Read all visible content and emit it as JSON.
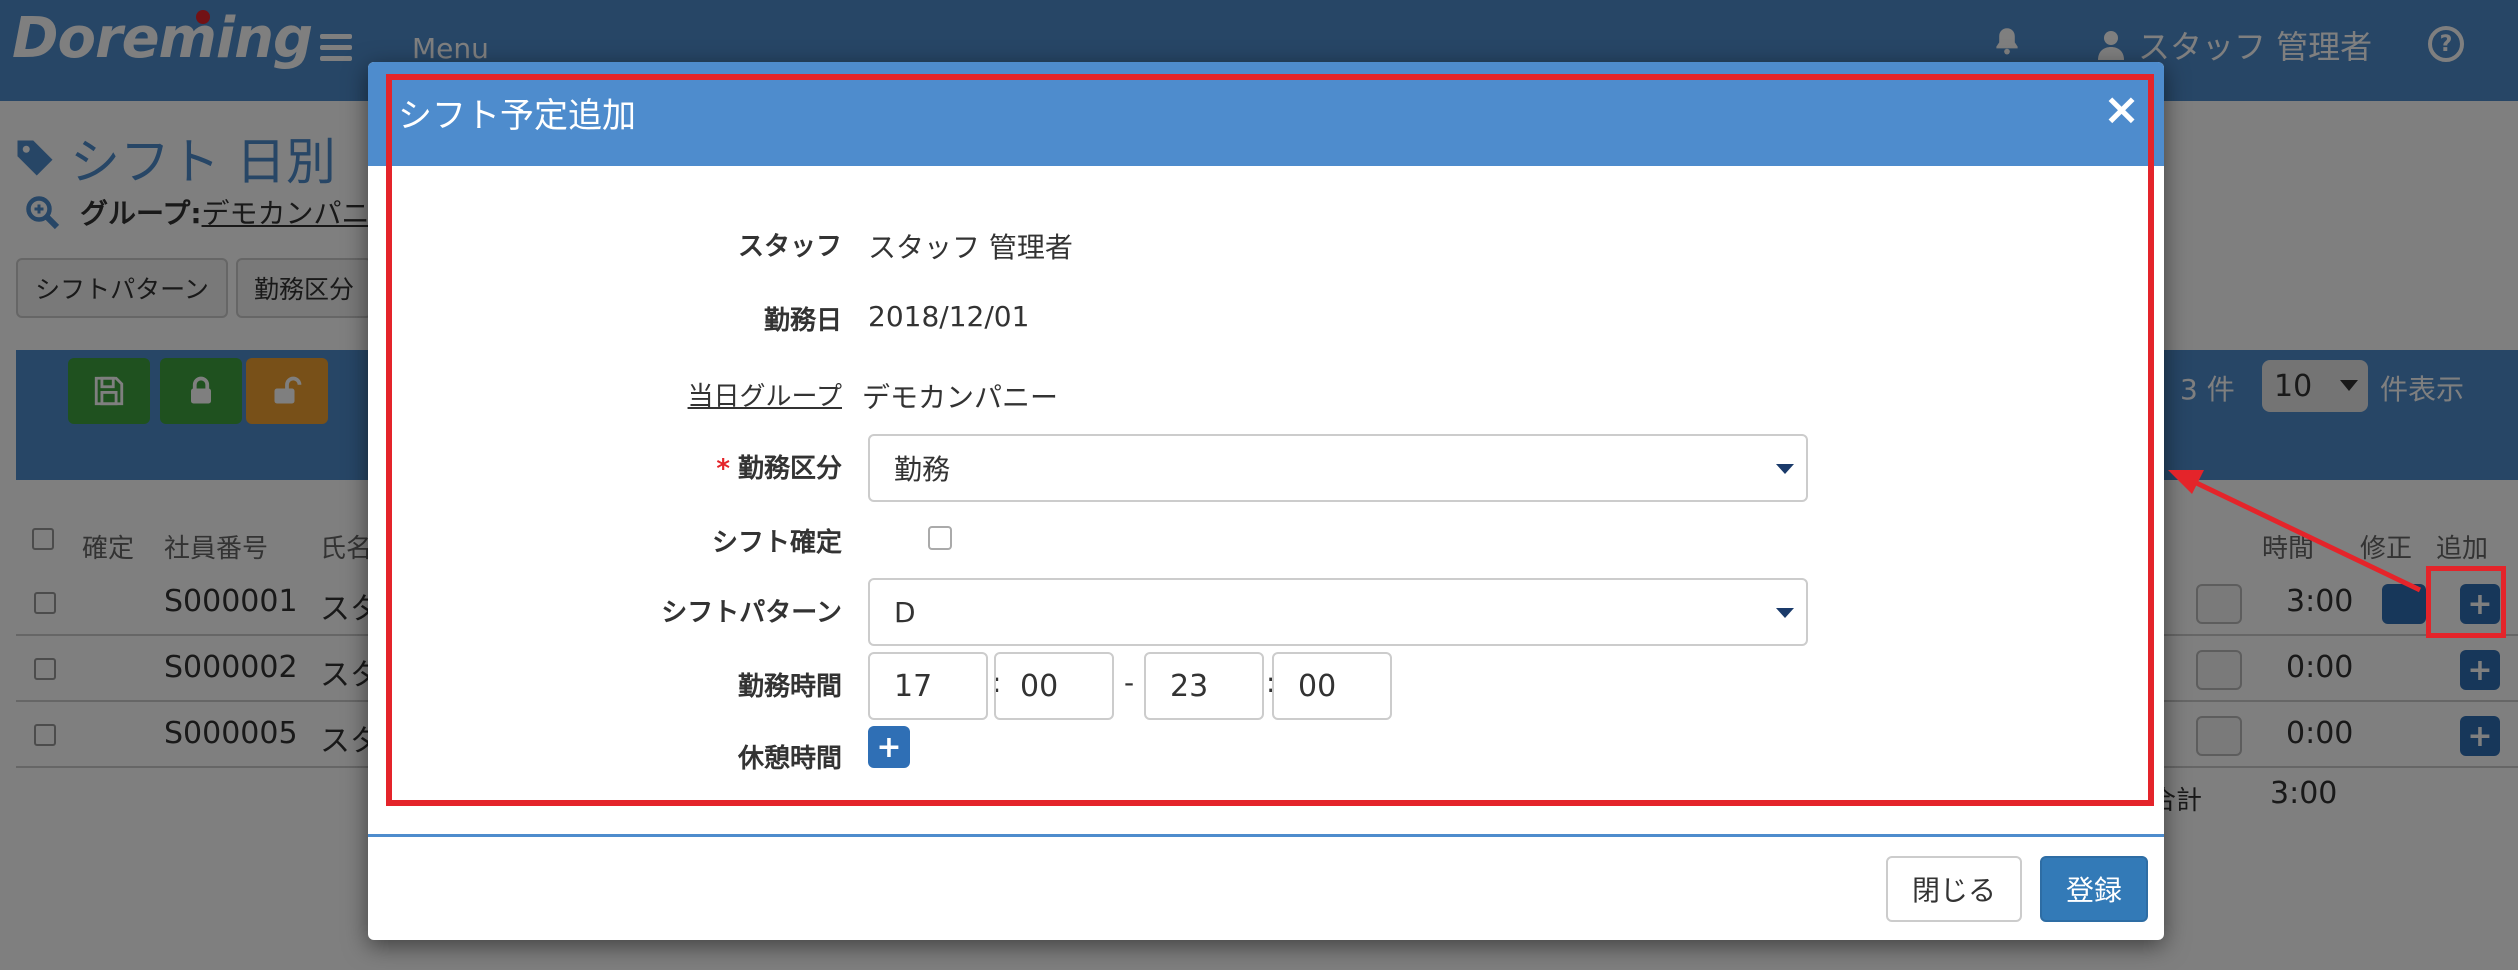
{
  "navbar": {
    "logo": "Doreming",
    "menu_label": "Menu",
    "user_name": "スタッフ 管理者",
    "help_glyph": "?"
  },
  "background": {
    "page_title": "シフト 日別",
    "group_label": "グループ:",
    "group_value": "デモカンパニ",
    "buttons": [
      "シフトパターン",
      "勤務区分"
    ],
    "count": "3 件",
    "page_size": "10",
    "per_page_label": "件表示",
    "columns": {
      "confirm": "確定",
      "employee_id": "社員番号",
      "name": "氏名",
      "time": "時間",
      "edit": "修正",
      "add": "追加"
    },
    "rows": [
      {
        "id": "S000001",
        "name": "スタ",
        "time": "3:00",
        "editable": true
      },
      {
        "id": "S000002",
        "name": "スタ",
        "time": "0:00",
        "editable": false
      },
      {
        "id": "S000005",
        "name": "スタ",
        "time": "0:00",
        "editable": false
      }
    ],
    "total_label": "合計",
    "total_value": "3:00"
  },
  "modal": {
    "title": "シフト予定追加",
    "close_glyph": "×",
    "fields": {
      "staff_label": "スタッフ",
      "staff_value": "スタッフ 管理者",
      "workday_label": "勤務日",
      "workday_value": "2018/12/01",
      "group_label": "当日グループ",
      "group_value": "デモカンパニー",
      "work_type_label": "勤務区分",
      "work_type_value": "勤務",
      "shift_confirm_label": "シフト確定",
      "shift_confirmed": false,
      "shift_pattern_label": "シフトパターン",
      "shift_pattern_value": "D",
      "work_time_label": "勤務時間",
      "start_hour": "17",
      "start_minute": "00",
      "end_hour": "23",
      "end_minute": "00",
      "break_label": "休憩時間"
    },
    "close_button": "閉じる",
    "submit_button": "登録"
  },
  "colors": {
    "header_blue": "#4e8ccd",
    "primary_button": "#337ab7",
    "annotation_red": "#e4242a",
    "save_green": "#3fa33f",
    "unlock_orange": "#f0a030"
  }
}
